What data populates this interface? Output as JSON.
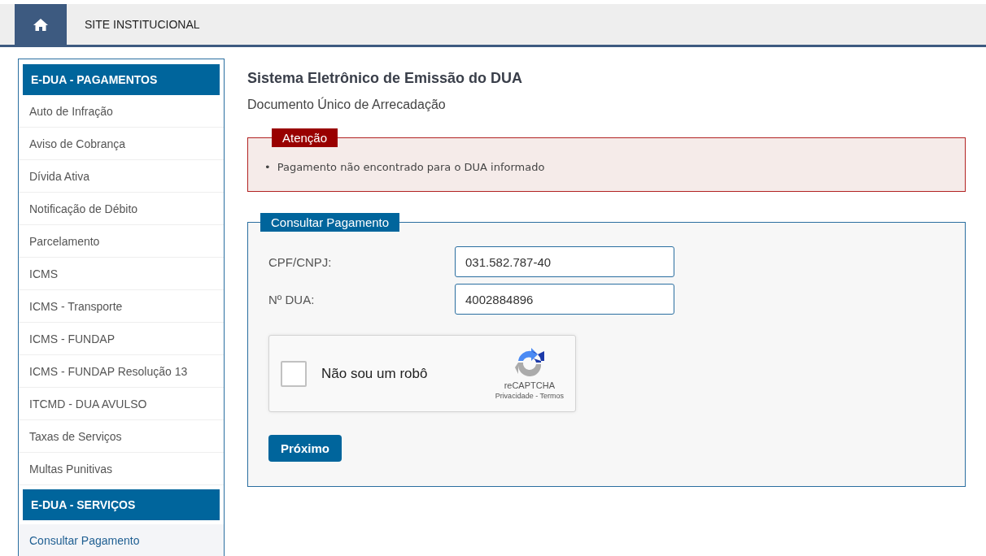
{
  "top_nav": {
    "items": [
      {
        "kind": "home",
        "selected": true
      },
      {
        "kind": "link",
        "label": "SITE INSTITUCIONAL",
        "selected": false
      }
    ]
  },
  "sidebar": {
    "sections": [
      {
        "title": "E-DUA - PAGAMENTOS",
        "items": [
          {
            "label": "Auto de Infração",
            "selected": false
          },
          {
            "label": "Aviso de Cobrança",
            "selected": false
          },
          {
            "label": "Dívida Ativa",
            "selected": false
          },
          {
            "label": "Notificação de Débito",
            "selected": false
          },
          {
            "label": "Parcelamento",
            "selected": false
          },
          {
            "label": "ICMS",
            "selected": false
          },
          {
            "label": "ICMS - Transporte",
            "selected": false
          },
          {
            "label": "ICMS - FUNDAP",
            "selected": false
          },
          {
            "label": "ICMS - FUNDAP Resolução 13",
            "selected": false
          },
          {
            "label": "ITCMD - DUA AVULSO",
            "selected": false
          },
          {
            "label": "Taxas de Serviços",
            "selected": false
          },
          {
            "label": "Multas Punitivas",
            "selected": false
          }
        ]
      },
      {
        "title": "E-DUA - SERVIÇOS",
        "items": [
          {
            "label": "Consultar Pagamento",
            "selected": true
          }
        ]
      }
    ]
  },
  "page": {
    "title": "Sistema Eletrônico de Emissão do DUA",
    "subtitle": "Documento Único de Arrecadação"
  },
  "alert": {
    "legend": "Atenção",
    "messages": [
      {
        "bullet": "•",
        "text": "Pagamento não encontrado para o DUA informado"
      }
    ]
  },
  "form": {
    "legend": "Consultar Pagamento",
    "fields": [
      {
        "label": "CPF/CNPJ:",
        "value": "031.582.787-40"
      },
      {
        "label": "Nº DUA:",
        "value": "4002884896"
      }
    ],
    "captcha": {
      "label": "Não sou um robô",
      "checked": false,
      "brand": "reCAPTCHA",
      "links": "Privacidade - Termos"
    },
    "submit": "Próximo"
  }
}
